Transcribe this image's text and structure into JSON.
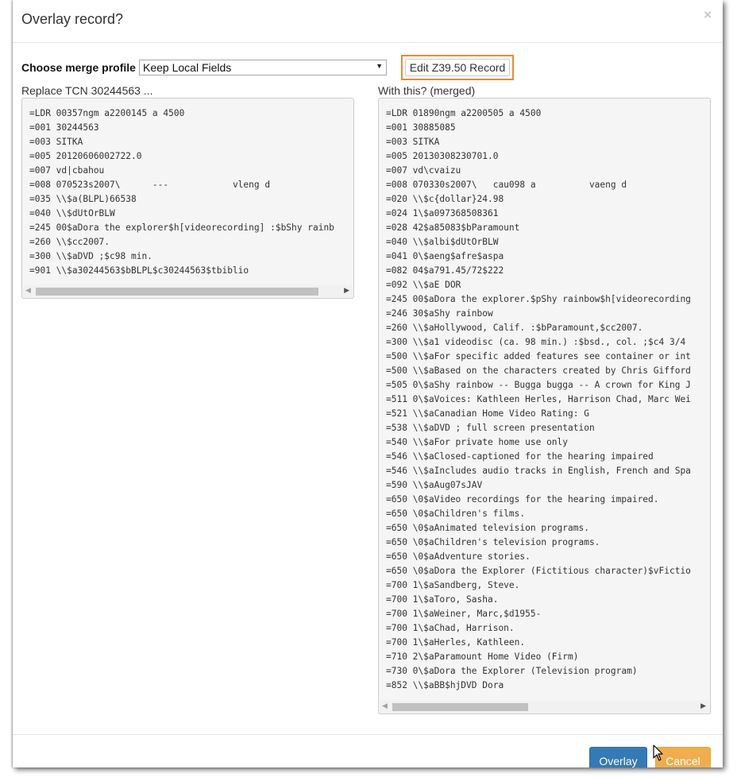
{
  "dialog": {
    "title": "Overlay record?",
    "close_glyph": "×"
  },
  "merge": {
    "label": "Choose merge profile",
    "selected_profile": "Keep Local Fields",
    "edit_button_label": "Edit Z39.50 Record"
  },
  "left_pane": {
    "heading": "Replace TCN 30244563 ...",
    "text": "=LDR 00357ngm a2200145 a 4500\n=001 30244563\n=003 SITKA\n=005 20120606002722.0\n=007 vd|cbahou\n=008 070523s2007\\      ---            vleng d\n=035 \\\\$a(BLPL)66538\n=040 \\\\$dUtOrBLW\n=245 00$aDora the explorer$h[videorecording] :$bShy rainb\n=260 \\\\$cc2007.\n=300 \\\\$aDVD ;$c98 min.\n=901 \\\\$a30244563$bBLPL$c30244563$tbiblio"
  },
  "right_pane": {
    "heading": "With this? (merged)",
    "text": "=LDR 01890ngm a2200505 a 4500\n=001 30885085\n=003 SITKA\n=005 20130308230701.0\n=007 vd\\cvaizu\n=008 070330s2007\\   cau098 a          vaeng d\n=020 \\\\$c{dollar}24.98\n=024 1\\$a097368508361\n=028 42$a85083$bParamount\n=040 \\\\$albi$dUtOrBLW\n=041 0\\$aeng$afre$aspa\n=082 04$a791.45/72$222\n=092 \\\\$aE DOR\n=245 00$aDora the explorer.$pShy rainbow$h[videorecording\n=246 30$aShy rainbow\n=260 \\\\$aHollywood, Calif. :$bParamount,$cc2007.\n=300 \\\\$a1 videodisc (ca. 98 min.) :$bsd., col. ;$c4 3/4\n=500 \\\\$aFor specific added features see container or int\n=500 \\\\$aBased on the characters created by Chris Gifford\n=505 0\\$aShy rainbow -- Bugga bugga -- A crown for King J\n=511 0\\$aVoices: Kathleen Herles, Harrison Chad, Marc Wei\n=521 \\\\$aCanadian Home Video Rating: G\n=538 \\\\$aDVD ; full screen presentation\n=540 \\\\$aFor private home use only\n=546 \\\\$aClosed-captioned for the hearing impaired\n=546 \\\\$aIncludes audio tracks in English, French and Spa\n=590 \\\\$aAug07sJAV\n=650 \\0$aVideo recordings for the hearing impaired.\n=650 \\0$aChildren's films.\n=650 \\0$aAnimated television programs.\n=650 \\0$aChildren's television programs.\n=650 \\0$aAdventure stories.\n=650 \\0$aDora the Explorer (Fictitious character)$vFictio\n=700 1\\$aSandberg, Steve.\n=700 1\\$aToro, Sasha.\n=700 1\\$aWeiner, Marc,$d1955-\n=700 1\\$aChad, Harrison.\n=700 1\\$aHerles, Kathleen.\n=710 2\\$aParamount Home Video (Firm)\n=730 0\\$aDora the Explorer (Television program)\n=852 \\\\$aBB$hjDVD Dora"
  },
  "footer": {
    "overlay_label": "Overlay",
    "cancel_label": "Cancel"
  },
  "colors": {
    "highlight_outline": "#ef8a2c",
    "primary_button": "#337ab7",
    "warning_button": "#f0ad4e"
  },
  "icons": {
    "select_arrow": "triangle-down-icon",
    "scroll_left": "triangle-left-icon",
    "scroll_right": "triangle-right-icon",
    "cursor": "mouse-pointer-icon"
  }
}
